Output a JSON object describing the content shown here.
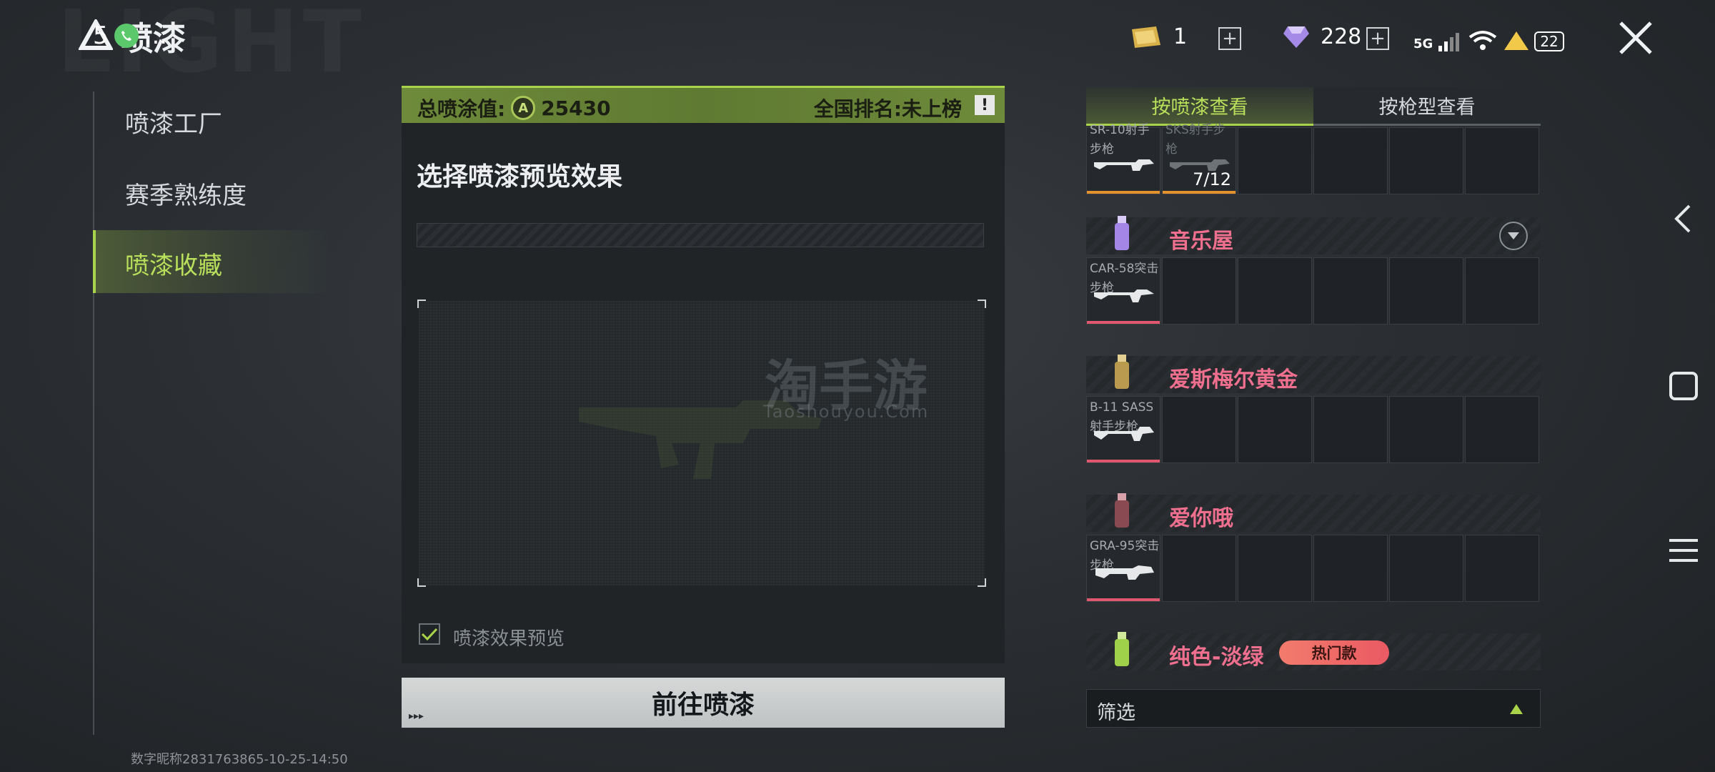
{
  "header": {
    "title": "喷漆",
    "status_overlay": "5",
    "status_dots": "...",
    "currency1": {
      "icon": "gold-bar-icon",
      "value": "1"
    },
    "currency2": {
      "icon": "diamond-icon",
      "value": "228"
    },
    "network_label": "5G",
    "battery": "22"
  },
  "nav": {
    "items": [
      {
        "label": "喷漆工厂"
      },
      {
        "label": "赛季熟练度"
      },
      {
        "label": "喷漆收藏"
      }
    ],
    "active_index": 2
  },
  "center": {
    "total_label": "总喷涂值:",
    "total_value": "25430",
    "rank_label": "全国排名:未上榜",
    "rank_info_icon": "!",
    "section_title": "选择喷漆预览效果",
    "watermark": "淘手游",
    "watermark_sub": "Taoshouyou.Com",
    "preview_checkbox_label": "喷漆效果预览",
    "preview_checked": true,
    "go_button": "前往喷漆",
    "go_arrows": "▸▸▸"
  },
  "right": {
    "tabs": [
      {
        "label": "按喷漆查看",
        "active": true
      },
      {
        "label": "按枪型查看",
        "active": false
      }
    ],
    "top_row": {
      "cells": [
        {
          "label": "SR-10射手步枪",
          "bar_color": "#e3922e"
        },
        {
          "label": "SKS射手步枪",
          "bar_color": "#e3922e",
          "count": "7/12"
        }
      ]
    },
    "collections": [
      {
        "name": "音乐屋",
        "icon": "spray-can-purple-icon",
        "weapon": "CAR-58突击步枪",
        "has_chevron": true
      },
      {
        "name": "爱斯梅尔黄金",
        "icon": "spray-can-gold-icon",
        "weapon": "B-11 SASS射手步枪"
      },
      {
        "name": "爱你哦",
        "icon": "spray-can-pink-icon",
        "weapon": "GRA-95突击步枪"
      },
      {
        "name": "纯色-淡绿",
        "icon": "spray-can-green-icon",
        "badge": "热门款"
      }
    ],
    "filter_label": "筛选"
  },
  "footer": {
    "id_text": "数字昵称2831763865-10-25-14:50"
  },
  "colors": {
    "accent_green": "#a9d34a",
    "collection_name": "#ee6f8e",
    "bar_pink": "#e0586f",
    "bar_orange": "#e3922e"
  }
}
